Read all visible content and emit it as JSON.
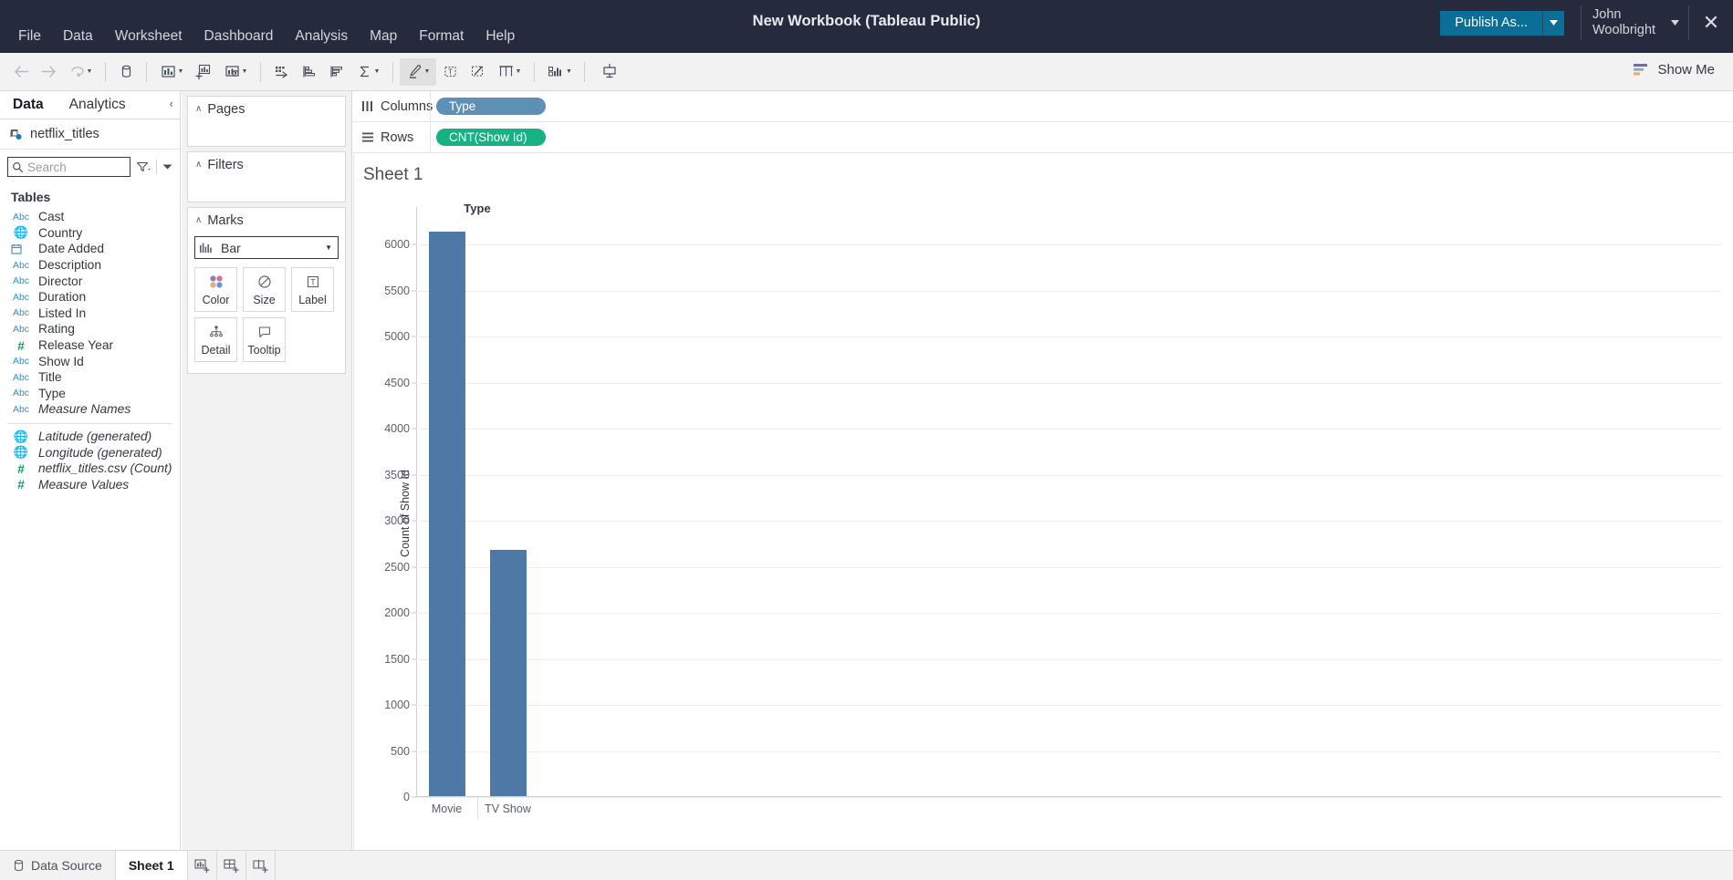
{
  "window": {
    "title": "New Workbook (Tableau Public)",
    "close_label": "✕"
  },
  "menubar": {
    "items": [
      {
        "label": "File"
      },
      {
        "label": "Data"
      },
      {
        "label": "Worksheet"
      },
      {
        "label": "Dashboard"
      },
      {
        "label": "Analysis"
      },
      {
        "label": "Map"
      },
      {
        "label": "Format"
      },
      {
        "label": "Help"
      }
    ]
  },
  "account": {
    "publish_label": "Publish As...",
    "user_name": "John Woolbright"
  },
  "toolbar": {
    "showme_label": "Show Me",
    "buttons": [
      {
        "name": "back-icon",
        "title": "Back"
      },
      {
        "name": "forward-icon",
        "title": "Forward"
      },
      {
        "name": "undo-redo-icon",
        "title": "Redo"
      },
      {
        "name": "save-icon",
        "title": "Save"
      },
      {
        "name": "new-data-source-icon",
        "title": "New Data Source"
      },
      {
        "name": "new-worksheet-icon",
        "title": "New Worksheet"
      },
      {
        "name": "duplicate-sheet-icon",
        "title": "Duplicate Sheet"
      },
      {
        "name": "clear-sheet-icon",
        "title": "Clear Sheet"
      },
      {
        "name": "swap-rows-cols-icon",
        "title": "Swap Rows and Columns"
      },
      {
        "name": "sort-ascending-icon",
        "title": "Sort Ascending"
      },
      {
        "name": "sort-descending-icon",
        "title": "Sort Descending"
      },
      {
        "name": "totals-icon",
        "title": "Totals"
      },
      {
        "name": "highlight-icon",
        "title": "Highlight"
      },
      {
        "name": "labels-icon",
        "title": "Show Mark Labels"
      },
      {
        "name": "format-icon",
        "title": "Fix Axes"
      },
      {
        "name": "cards-icon",
        "title": "Show/Hide Cards"
      },
      {
        "name": "fit-icon",
        "title": "Fit"
      },
      {
        "name": "presentation-icon",
        "title": "Presentation Mode"
      }
    ]
  },
  "data_pane": {
    "tabs": [
      {
        "label": "Data",
        "active": true
      },
      {
        "label": "Analytics",
        "active": false
      }
    ],
    "collapse_icon": "‹",
    "data_source": "netflix_titles",
    "search_placeholder": "Search",
    "search_value": "",
    "tables_heading": "Tables",
    "fields": [
      {
        "label": "Cast",
        "icon": "abc",
        "italic": false
      },
      {
        "label": "Country",
        "icon": "globe",
        "italic": false
      },
      {
        "label": "Date Added",
        "icon": "date",
        "italic": false
      },
      {
        "label": "Description",
        "icon": "abc",
        "italic": false
      },
      {
        "label": "Director",
        "icon": "abc",
        "italic": false
      },
      {
        "label": "Duration",
        "icon": "abc",
        "italic": false
      },
      {
        "label": "Listed In",
        "icon": "abc",
        "italic": false
      },
      {
        "label": "Rating",
        "icon": "abc",
        "italic": false
      },
      {
        "label": "Release Year",
        "icon": "hash-green",
        "italic": false
      },
      {
        "label": "Show Id",
        "icon": "abc",
        "italic": false
      },
      {
        "label": "Title",
        "icon": "abc",
        "italic": false
      },
      {
        "label": "Type",
        "icon": "abc",
        "italic": false
      },
      {
        "label": "Measure Names",
        "icon": "abc",
        "italic": true
      }
    ],
    "measures": [
      {
        "label": "Latitude (generated)",
        "icon": "globe-green",
        "italic": true
      },
      {
        "label": "Longitude (generated)",
        "icon": "globe-green",
        "italic": true
      },
      {
        "label": "netflix_titles.csv (Count)",
        "icon": "hash-green",
        "italic": true
      },
      {
        "label": "Measure Values",
        "icon": "hash-green",
        "italic": true
      }
    ]
  },
  "cards": {
    "pages": {
      "title": "Pages",
      "chevron": "∧"
    },
    "filters": {
      "title": "Filters",
      "chevron": "∧"
    },
    "marks": {
      "title": "Marks",
      "chevron": "∧",
      "type_label": "Bar",
      "type_caret": "▼",
      "buttons": [
        {
          "label": "Color",
          "icon": "color-icon"
        },
        {
          "label": "Size",
          "icon": "size-icon"
        },
        {
          "label": "Label",
          "icon": "label-icon"
        },
        {
          "label": "Detail",
          "icon": "detail-icon"
        },
        {
          "label": "Tooltip",
          "icon": "tooltip-icon"
        }
      ]
    }
  },
  "shelves": {
    "columns": {
      "label": "Columns",
      "pills": [
        {
          "text": "Type",
          "color": "blue"
        }
      ]
    },
    "rows": {
      "label": "Rows",
      "pills": [
        {
          "text": "CNT(Show Id)",
          "color": "green"
        }
      ]
    }
  },
  "worksheet": {
    "title": "Sheet 1"
  },
  "chart_data": {
    "type": "bar",
    "title": "Sheet 1",
    "column_header": "Type",
    "categories": [
      "Movie",
      "TV Show"
    ],
    "values": [
      6131,
      2676
    ],
    "xlabel": "Type",
    "ylabel": "Count of Show Id",
    "ylim": [
      0,
      6250
    ],
    "yticks": [
      0,
      500,
      1000,
      1500,
      2000,
      2500,
      3000,
      3500,
      4000,
      4500,
      5000,
      5500,
      6000
    ],
    "ytick_labels": [
      "0",
      "500",
      "1000",
      "1500",
      "2000",
      "2500",
      "3000",
      "3500",
      "4000",
      "4500",
      "5000",
      "5500",
      "6000"
    ],
    "grid": true,
    "legend": "none",
    "bar_color": "#4E79A7"
  },
  "bottom_bar": {
    "data_source_label": "Data Source",
    "sheet_label": "Sheet 1",
    "new_worksheet_title": "New Worksheet",
    "new_dashboard_title": "New Dashboard",
    "new_story_title": "New Story"
  },
  "colors": {
    "titlebar_bg": "#252A3D",
    "publish_blue": "#0A6E96",
    "pill_blue": "#5E8FB4",
    "pill_green": "#16B184",
    "bar_blue": "#4E79A7",
    "dimension_blue": "#3B8EC1",
    "measure_green": "#179A6E"
  }
}
